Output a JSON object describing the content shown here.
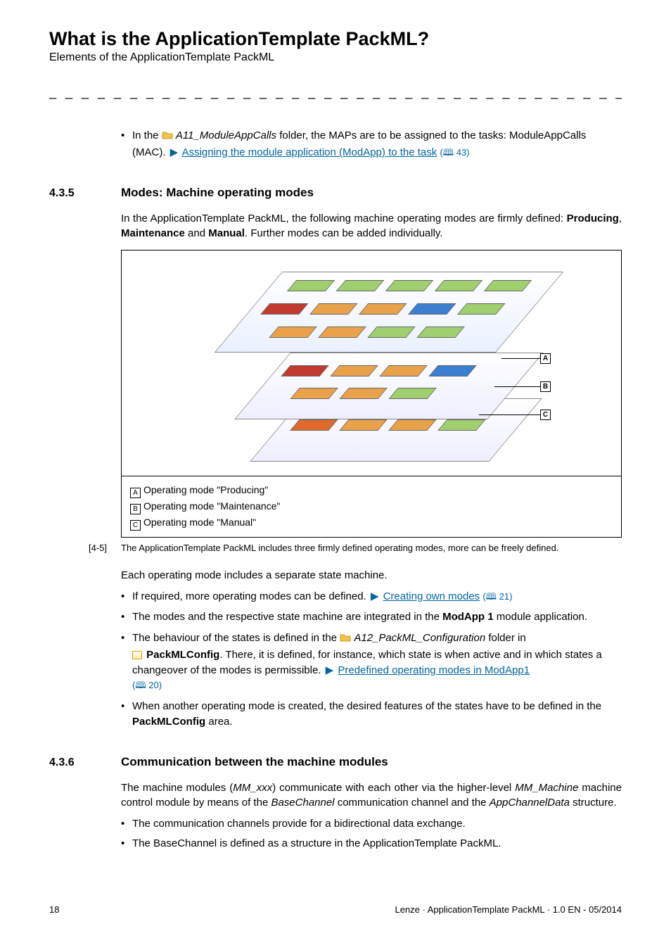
{
  "header": {
    "title": "What is the ApplicationTemplate PackML?",
    "subtitle": "Elements of the ApplicationTemplate PackML"
  },
  "intro_bullet": {
    "prefix": "In the ",
    "folder": "A11_ModuleAppCalls",
    "mid": " folder, the MAPs are to be assigned to the tasks: ModuleAppCalls (MAC). ",
    "link": "Assigning the module application (ModApp) to the task",
    "pgref": " 43)"
  },
  "s435": {
    "num": "4.3.5",
    "head": "Modes: Machine operating modes",
    "p1a": "In the ApplicationTemplate PackML, the following machine operating modes are firmly defined: ",
    "p1b": "Producing",
    "p1c": ", ",
    "p1d": "Maintenance",
    "p1e": " and ",
    "p1f": "Manual",
    "p1g": ". Further modes can be added individually.",
    "legend_a": "Operating mode \"Producing\"",
    "legend_b": "Operating mode \"Maintenance\"",
    "legend_c": "Operating mode \"Manual\"",
    "fig_num": "[4-5]",
    "fig_cap": "The ApplicationTemplate PackML includes three firmly defined operating modes, more can be freely defined.",
    "p2": "Each operating mode includes a separate state machine.",
    "b1a": "If required, more operating modes can be defined.  ",
    "b1link": "Creating own modes",
    "b1pg": " 21)",
    "b2a": "The modes and the respective state machine are integrated in the ",
    "b2b": "ModApp 1",
    "b2c": " module application.",
    "b3a": "The behaviour of the states is defined in the ",
    "b3folder": "A12_PackML_Configuration",
    "b3b": " folder in ",
    "b3c": "PackMLConfig",
    "b3d": ". There, it is defined, for instance, which state is when active and in which states a changeover of the modes is permissible.  ",
    "b3link": "Predefined operating modes in ModApp1",
    "b3pg": " 20)",
    "b4a": "When another operating mode is created, the desired features of the states have to be defined in the ",
    "b4b": "PackMLConfig",
    "b4c": " area."
  },
  "s436": {
    "num": "4.3.6",
    "head": "Communication between the machine modules",
    "p1a": "The machine modules (",
    "p1b": "MM_xxx",
    "p1c": ") communicate with each other via the higher-level ",
    "p1d": "MM_Machine",
    "p1e": " machine control module by means of the ",
    "p1f": "BaseChannel",
    "p1g": " communication channel and the ",
    "p1h": "AppChannelData",
    "p1i": " structure.",
    "b1": "The communication channels provide for a bidirectional data exchange.",
    "b2": "The BaseChannel is defined as a structure in the ApplicationTemplate PackML."
  },
  "footer": {
    "page": "18",
    "right": "Lenze · ApplicationTemplate PackML · 1.0 EN - 05/2014"
  },
  "markers": {
    "A": "A",
    "B": "B",
    "C": "C"
  }
}
